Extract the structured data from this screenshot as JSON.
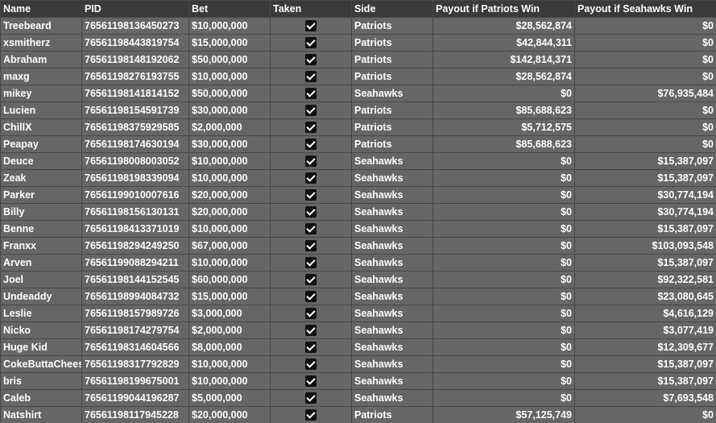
{
  "columns": [
    "Name",
    "PID",
    "Bet",
    "Taken",
    "Side",
    "Payout if Patriots Win",
    "Payout if Seahawks Win"
  ],
  "rows": [
    {
      "name": "Treebeard",
      "pid": "76561198136450273",
      "bet": "$10,000,000",
      "taken": true,
      "side": "Patriots",
      "pat": "$28,562,874",
      "sea": "$0"
    },
    {
      "name": "xsmitherz",
      "pid": "76561198443819754",
      "bet": "$15,000,000",
      "taken": true,
      "side": "Patriots",
      "pat": "$42,844,311",
      "sea": "$0"
    },
    {
      "name": "Abraham",
      "pid": "76561198148192062",
      "bet": "$50,000,000",
      "taken": true,
      "side": "Patriots",
      "pat": "$142,814,371",
      "sea": "$0"
    },
    {
      "name": "maxg",
      "pid": "76561198276193755",
      "bet": "$10,000,000",
      "taken": true,
      "side": "Patriots",
      "pat": "$28,562,874",
      "sea": "$0"
    },
    {
      "name": "mikey",
      "pid": "76561198141814152",
      "bet": "$50,000,000",
      "taken": true,
      "side": "Seahawks",
      "pat": "$0",
      "sea": "$76,935,484"
    },
    {
      "name": "Lucien",
      "pid": "76561198154591739",
      "bet": "$30,000,000",
      "taken": true,
      "side": "Patriots",
      "pat": "$85,688,623",
      "sea": "$0"
    },
    {
      "name": "ChillX",
      "pid": "76561198375929585",
      "bet": "$2,000,000",
      "taken": true,
      "side": "Patriots",
      "pat": "$5,712,575",
      "sea": "$0"
    },
    {
      "name": "Peapay",
      "pid": "76561198174630194",
      "bet": "$30,000,000",
      "taken": true,
      "side": "Patriots",
      "pat": "$85,688,623",
      "sea": "$0"
    },
    {
      "name": "Deuce",
      "pid": "76561198008003052",
      "bet": "$10,000,000",
      "taken": true,
      "side": "Seahawks",
      "pat": "$0",
      "sea": "$15,387,097"
    },
    {
      "name": "Zeak",
      "pid": "76561198198339094",
      "bet": "$10,000,000",
      "taken": true,
      "side": "Seahawks",
      "pat": "$0",
      "sea": "$15,387,097"
    },
    {
      "name": "Parker",
      "pid": "76561199010007616",
      "bet": "$20,000,000",
      "taken": true,
      "side": "Seahawks",
      "pat": "$0",
      "sea": "$30,774,194"
    },
    {
      "name": "Billy",
      "pid": "76561198156130131",
      "bet": "$20,000,000",
      "taken": true,
      "side": "Seahawks",
      "pat": "$0",
      "sea": "$30,774,194"
    },
    {
      "name": "Benne",
      "pid": "76561198413371019",
      "bet": "$10,000,000",
      "taken": true,
      "side": "Seahawks",
      "pat": "$0",
      "sea": "$15,387,097"
    },
    {
      "name": "Franxx",
      "pid": "76561198294249250",
      "bet": "$67,000,000",
      "taken": true,
      "side": "Seahawks",
      "pat": "$0",
      "sea": "$103,093,548"
    },
    {
      "name": "Arven",
      "pid": "76561199088294211",
      "bet": "$10,000,000",
      "taken": true,
      "side": "Seahawks",
      "pat": "$0",
      "sea": "$15,387,097"
    },
    {
      "name": "Joel",
      "pid": "76561198144152545",
      "bet": "$60,000,000",
      "taken": true,
      "side": "Seahawks",
      "pat": "$0",
      "sea": "$92,322,581"
    },
    {
      "name": "Undeaddy",
      "pid": "76561198994084732",
      "bet": "$15,000,000",
      "taken": true,
      "side": "Seahawks",
      "pat": "$0",
      "sea": "$23,080,645"
    },
    {
      "name": "Leslie",
      "pid": "76561198157989726",
      "bet": "$3,000,000",
      "taken": true,
      "side": "Seahawks",
      "pat": "$0",
      "sea": "$4,616,129"
    },
    {
      "name": "Nicko",
      "pid": "76561198174279754",
      "bet": "$2,000,000",
      "taken": true,
      "side": "Seahawks",
      "pat": "$0",
      "sea": "$3,077,419"
    },
    {
      "name": "Huge Kid",
      "pid": "76561198314604566",
      "bet": "$8,000,000",
      "taken": true,
      "side": "Seahawks",
      "pat": "$0",
      "sea": "$12,309,677"
    },
    {
      "name": "CokeButtaCheese",
      "pid": "76561198317792829",
      "bet": "$10,000,000",
      "taken": true,
      "side": "Seahawks",
      "pat": "$0",
      "sea": "$15,387,097"
    },
    {
      "name": "bris",
      "pid": "76561198199675001",
      "bet": "$10,000,000",
      "taken": true,
      "side": "Seahawks",
      "pat": "$0",
      "sea": "$15,387,097"
    },
    {
      "name": "Caleb",
      "pid": "76561199044196287",
      "bet": "$5,000,000",
      "taken": true,
      "side": "Seahawks",
      "pat": "$0",
      "sea": "$7,693,548"
    },
    {
      "name": "Natshirt",
      "pid": "76561198117945228",
      "bet": "$20,000,000",
      "taken": true,
      "side": "Patriots",
      "pat": "$57,125,749",
      "sea": "$0"
    }
  ]
}
